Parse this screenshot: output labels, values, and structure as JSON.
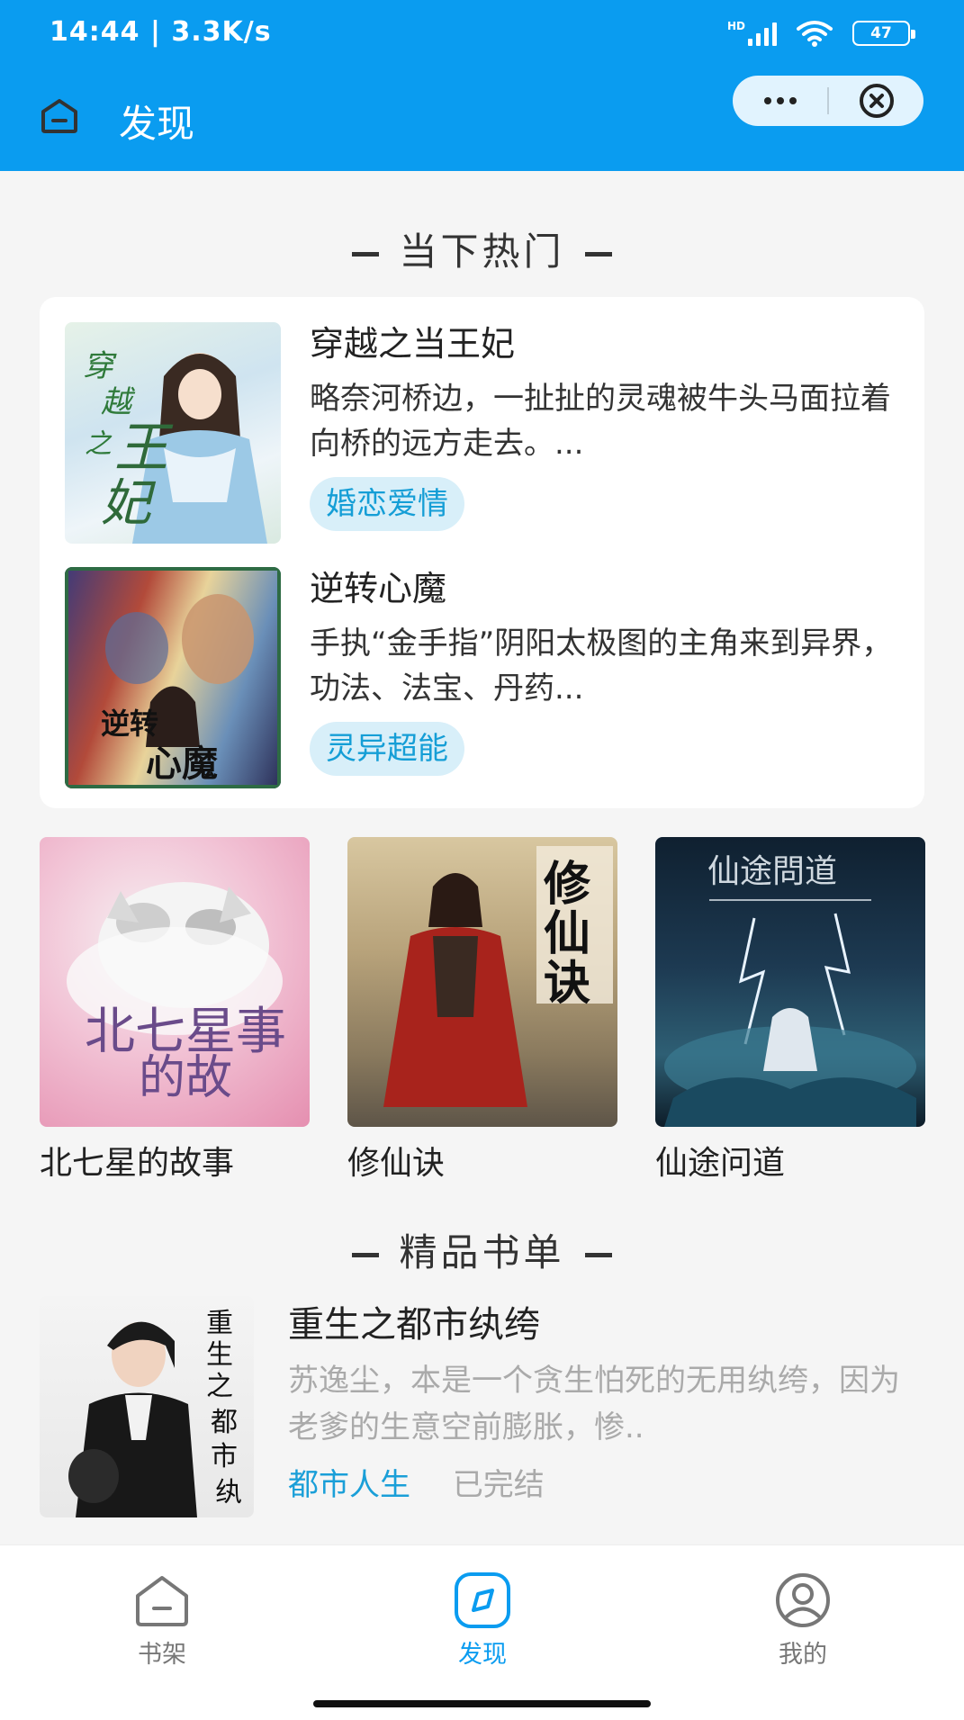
{
  "status_bar": {
    "time": "14:44 | 3.3K/s",
    "network": "HD",
    "battery": "47"
  },
  "nav": {
    "title": "发现"
  },
  "sections": {
    "hot_title": "当下热门",
    "premium_title": "精品书单"
  },
  "hot_books": [
    {
      "title": "穿越之当王妃",
      "description": "略奈河桥边，一扯扯的灵魂被牛头马面拉着向桥的远方走去。...",
      "tag": "婚恋爱情",
      "cover_text": "穿越之当王妃"
    },
    {
      "title": "逆转心魔",
      "description": "手执“金手指”阴阳太极图的主角来到异界，功法、法宝、丹药...",
      "tag": "灵异超能",
      "cover_text": "逆转心魔"
    }
  ],
  "grid_books": [
    {
      "title": "北七星的故事",
      "cover_text": "北七星事的故"
    },
    {
      "title": "修仙诀",
      "cover_text": "修仙诀"
    },
    {
      "title": "仙途问道",
      "cover_text": "仙途問道"
    }
  ],
  "premium_books": [
    {
      "title": "重生之都市纨绔",
      "description": "苏逸尘，本是一个贪生怕死的无用纨绔，因为老爹的生意空前膨胀，惨..",
      "category": "都市人生",
      "status": "已完结",
      "cover_text": "重生之都市纨绔"
    }
  ],
  "tabbar": {
    "items": [
      {
        "label": "书架",
        "icon": "bookshelf-icon"
      },
      {
        "label": "发现",
        "icon": "discover-icon"
      },
      {
        "label": "我的",
        "icon": "profile-icon"
      }
    ]
  },
  "colors": {
    "primary": "#0a9cf0",
    "tag_bg": "#d8eff9",
    "tag_text": "#159ed6",
    "background": "#f5f5f5"
  }
}
